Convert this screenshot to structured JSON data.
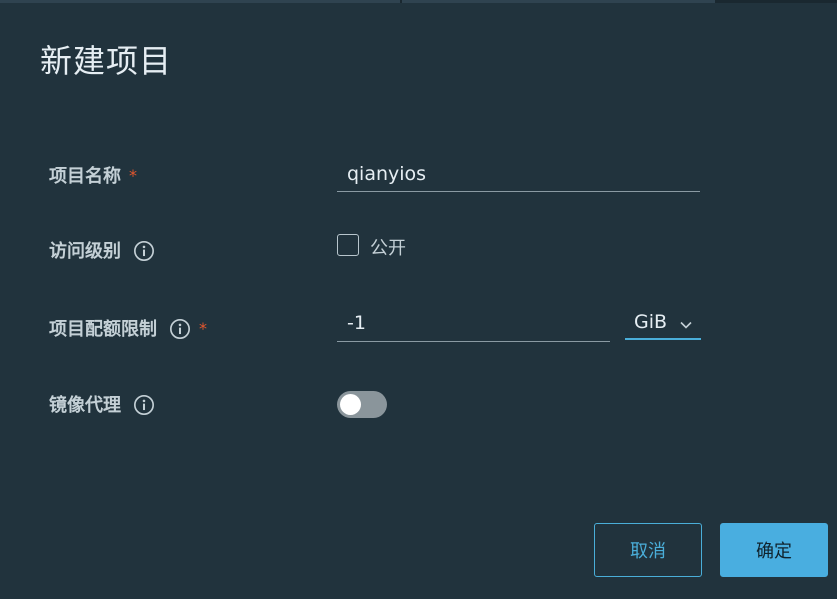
{
  "dialog": {
    "title": "新建项目"
  },
  "form": {
    "project_name": {
      "label": "项目名称",
      "required_mark": "*",
      "value": "qianyios"
    },
    "access_level": {
      "label": "访问级别",
      "public_checkbox_label": "公开",
      "public_checked": false
    },
    "quota": {
      "label": "项目配额限制",
      "required_mark": "*",
      "value": "-1",
      "unit": "GiB"
    },
    "proxy_cache": {
      "label": "镜像代理",
      "enabled": false
    }
  },
  "footer": {
    "cancel_label": "取消",
    "confirm_label": "确定"
  },
  "colors": {
    "background": "#21333d",
    "accent": "#49aee0",
    "required": "#e4572e"
  }
}
